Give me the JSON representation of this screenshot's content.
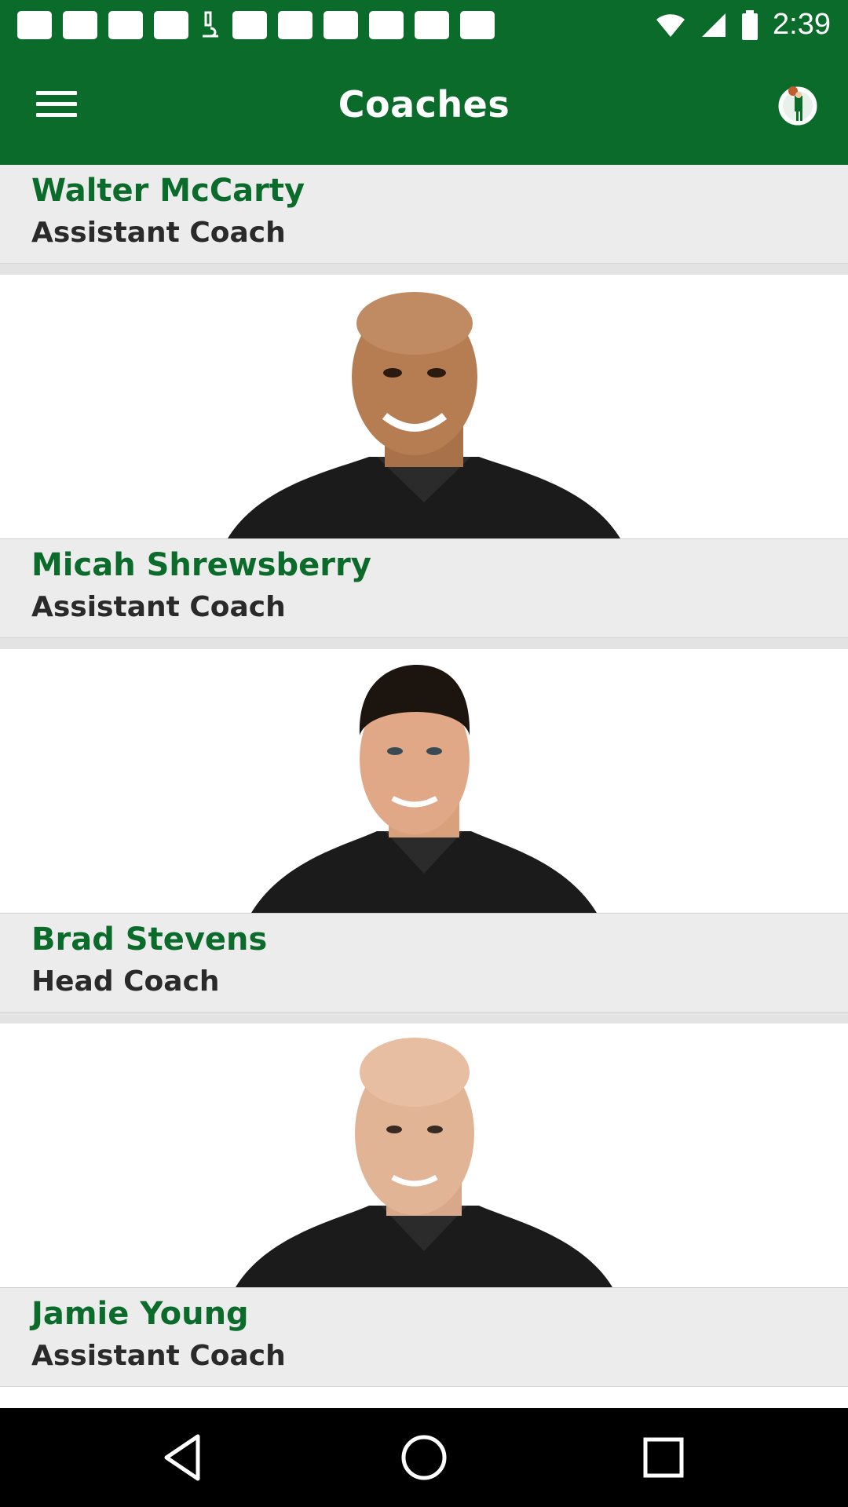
{
  "status_bar": {
    "time": "2:39",
    "notification_icons": [
      "messages-icon",
      "facebook-icon",
      "notification-icon",
      "notification-icon",
      "microscope-icon",
      "notification-icon",
      "notification-icon",
      "notification-icon",
      "notification-icon",
      "notification-icon",
      "notification-icon"
    ]
  },
  "app_bar": {
    "title": "Coaches",
    "menu_icon": "menu-icon",
    "logo_icon": "celtics-logo-icon"
  },
  "coaches": [
    {
      "name": "Walter McCarty",
      "role": "Assistant Coach"
    },
    {
      "name": "Micah Shrewsberry",
      "role": "Assistant Coach"
    },
    {
      "name": "Brad Stevens",
      "role": "Head Coach"
    },
    {
      "name": "Jamie Young",
      "role": "Assistant Coach"
    }
  ],
  "nav_bar": {
    "back": "back-icon",
    "home": "home-icon",
    "recents": "recents-icon"
  },
  "colors": {
    "brand_green": "#0b6b2b",
    "card_gray": "#ececec"
  }
}
